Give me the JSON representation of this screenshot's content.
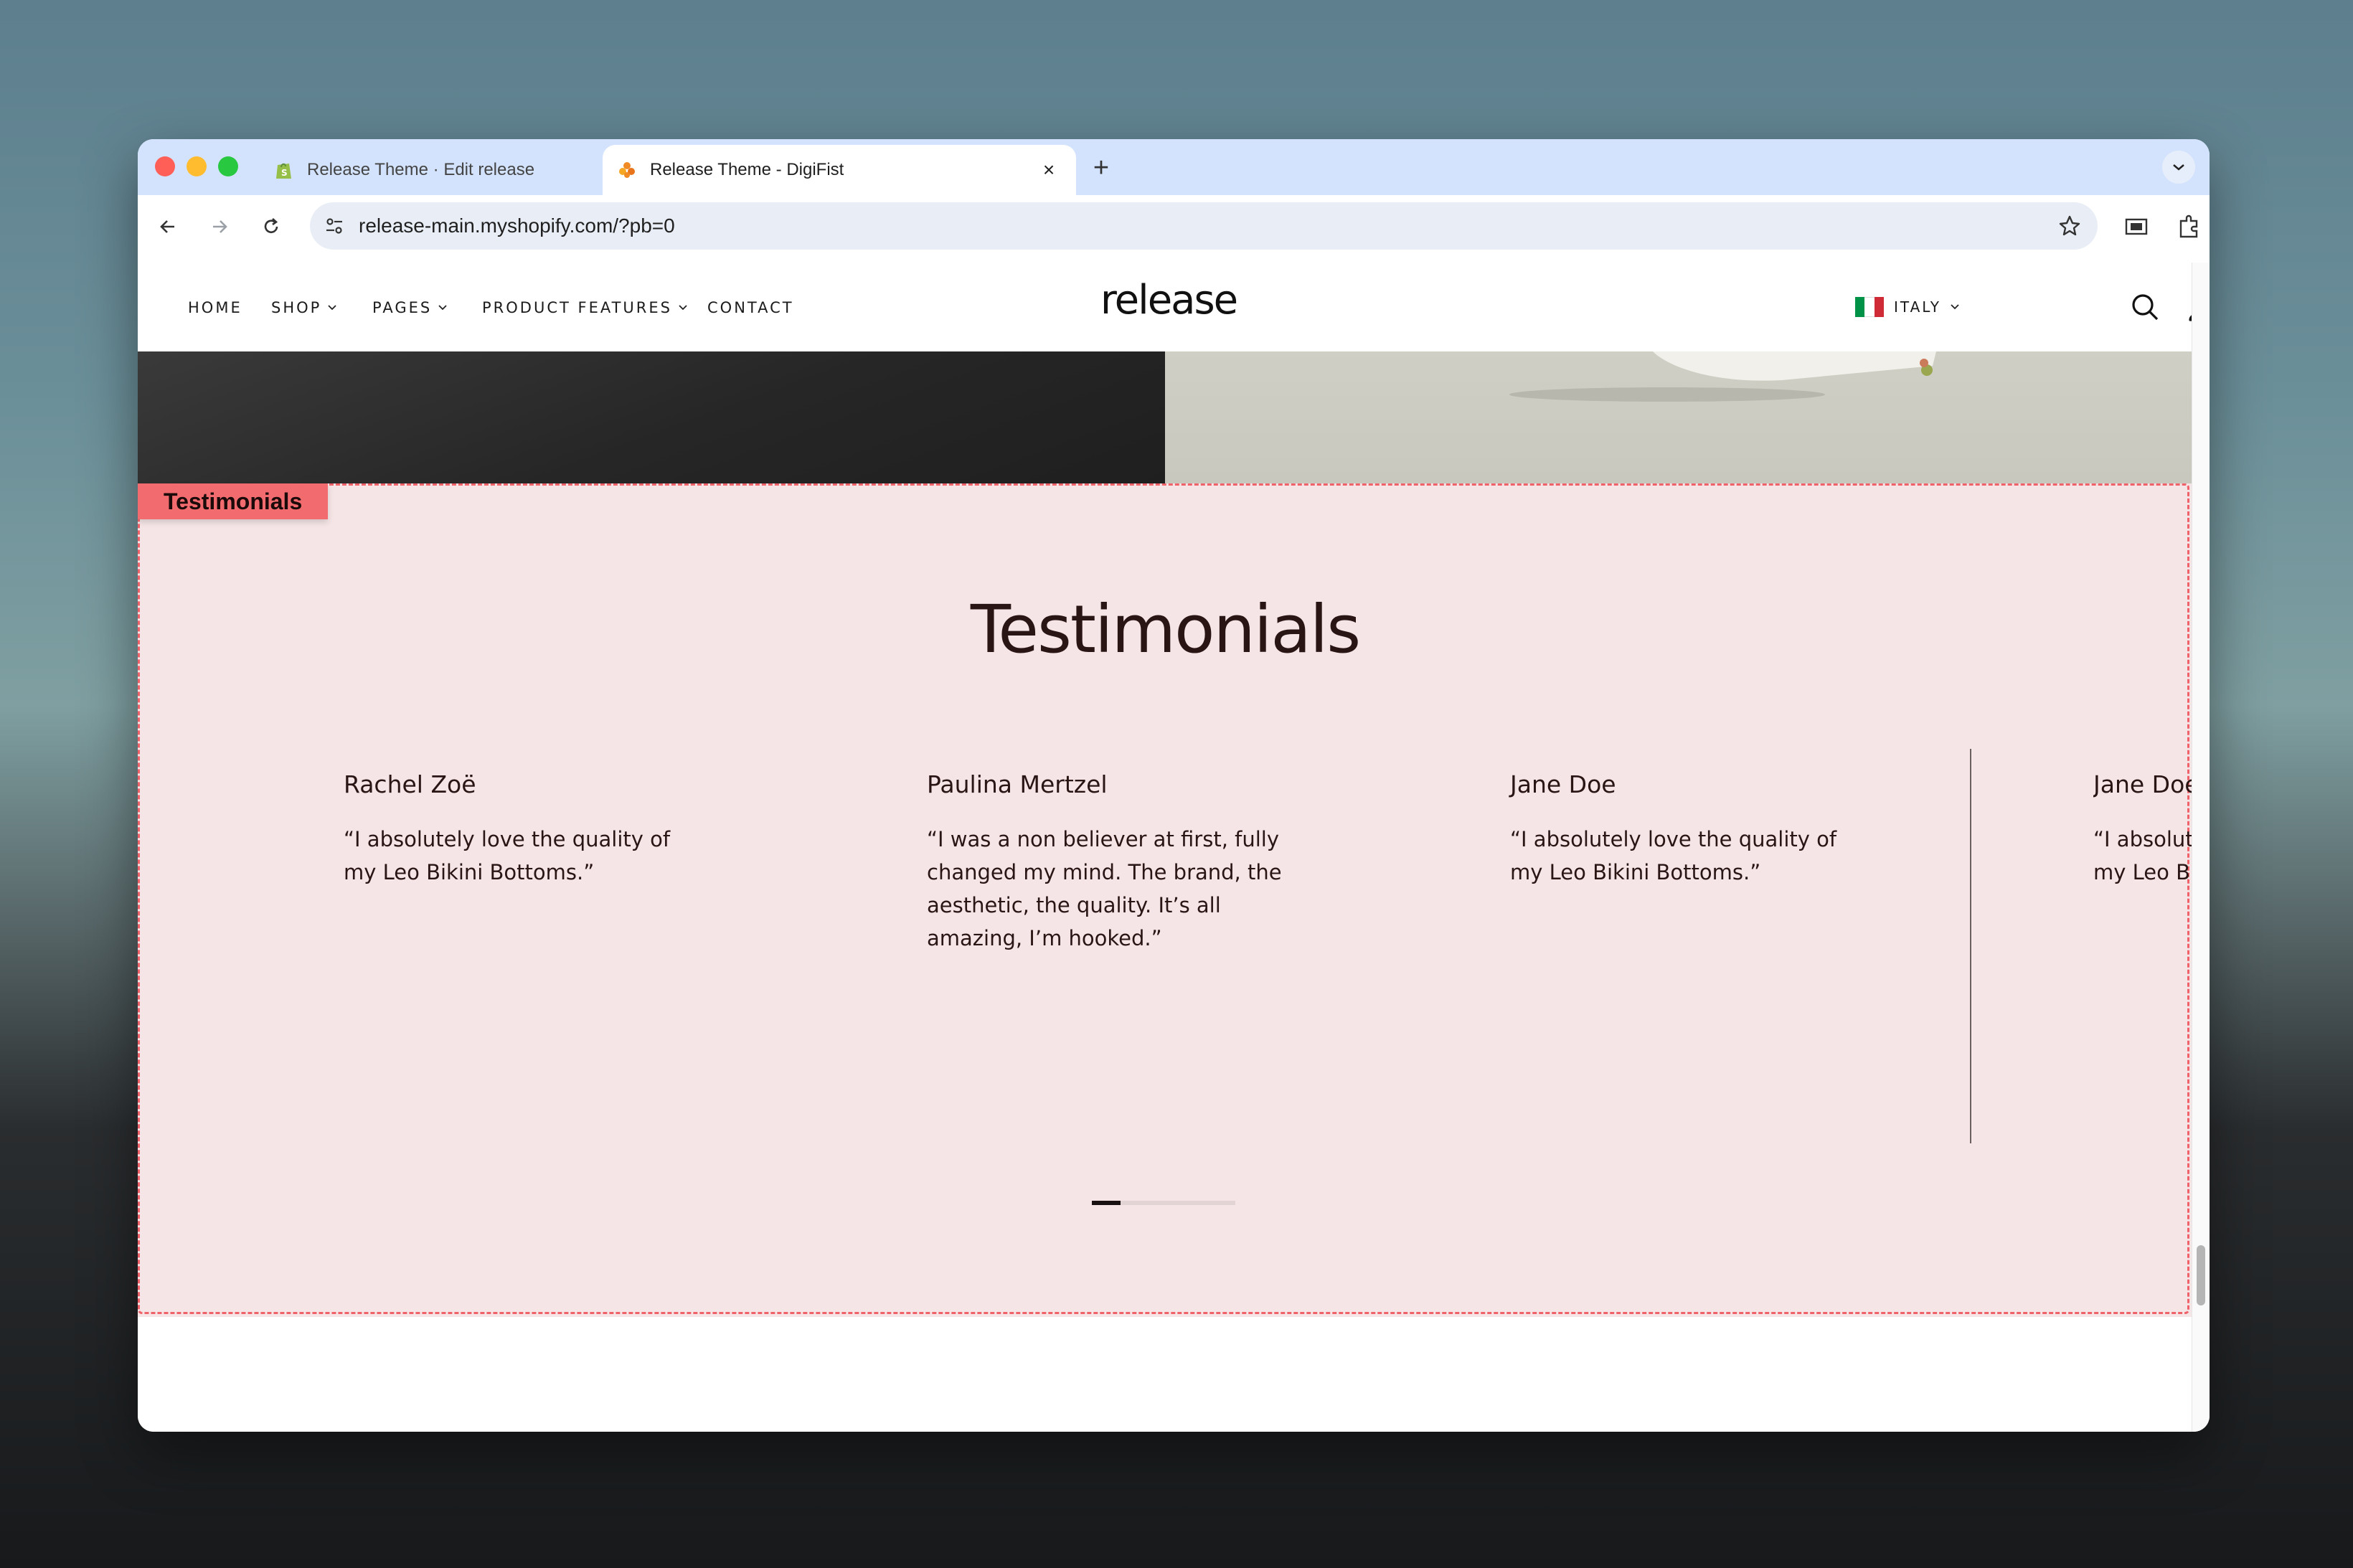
{
  "browser": {
    "tabs": [
      {
        "title": "Release Theme · Edit release",
        "active": false,
        "favicon": "shopify-icon"
      },
      {
        "title": "Release Theme - DigiFist",
        "active": true,
        "favicon": "digifist-icon"
      }
    ],
    "url": "release-main.myshopify.com/?pb=0"
  },
  "store": {
    "nav": [
      {
        "label": "HOME",
        "has_dropdown": false
      },
      {
        "label": "SHOP",
        "has_dropdown": true
      },
      {
        "label": "PAGES",
        "has_dropdown": true
      },
      {
        "label": "PRODUCT FEATURES",
        "has_dropdown": true
      },
      {
        "label": "CONTACT",
        "has_dropdown": false
      }
    ],
    "logo": "release",
    "country": {
      "label": "ITALY",
      "flag_colors": [
        "#009246",
        "#ffffff",
        "#ce2b37"
      ]
    }
  },
  "section": {
    "tag": "Testimonials",
    "title": "Testimonials",
    "testimonials": [
      {
        "name": "Rachel Zoë",
        "quote": "“I absolutely love the quality of my Leo Bikini Bottoms.”"
      },
      {
        "name": "Paulina Mertzel",
        "quote": "“I was a non believer at first, fully changed my mind. The brand, the aesthetic, the quality. It’s all amazing, I’m hooked.”"
      },
      {
        "name": "Jane Doe",
        "quote": "“I absolutely love the quality of my Leo Bikini Bottoms.”"
      },
      {
        "name": "Jane Doe",
        "quote": "“I absolutely love the quality of my Leo Bikini Bottoms.”"
      }
    ],
    "slider_progress": 0.2
  },
  "colors": {
    "section_bg": "#f5e5e6",
    "outline": "#f0626a",
    "tab_bar": "#d3e3fd"
  }
}
